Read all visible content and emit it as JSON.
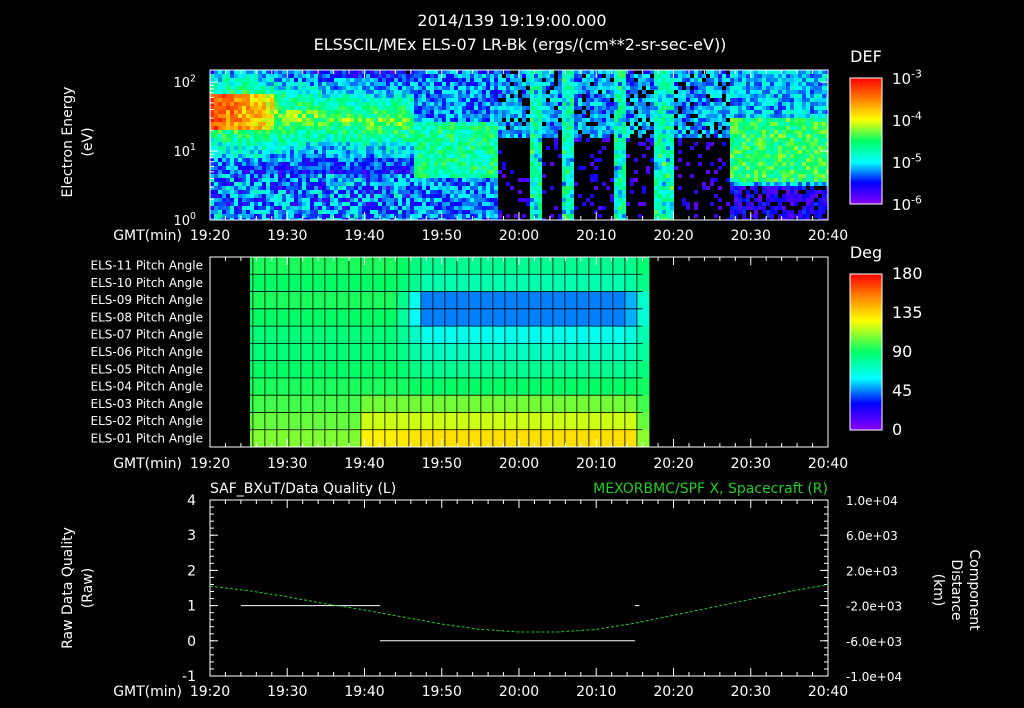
{
  "header": {
    "timestamp": "2014/139 19:19:00.000",
    "title": "ELSSCIL/MEx ELS-07 LR-Bk  (ergs/(cm**2-sr-sec-eV))"
  },
  "colors": {
    "foreground": "#ffffff",
    "background": "#000000",
    "spacecraft_trace": "#22cc22",
    "quality_trace": "#ffffff"
  },
  "time_axis": {
    "label": "GMT(min)",
    "ticks": [
      "19:20",
      "19:30",
      "19:40",
      "19:50",
      "20:00",
      "20:10",
      "20:20",
      "20:30",
      "20:40"
    ],
    "range_min": [
      20,
      100
    ]
  },
  "chart_data": [
    {
      "type": "heatmap",
      "ylabel": "Electron Energy (eV)",
      "ylabel_lines": [
        "Electron Energy",
        "(eV)"
      ],
      "y_scale": "log",
      "ylim": [
        1,
        150
      ],
      "yticks": [
        {
          "value": 1,
          "base": "10",
          "exp": "0"
        },
        {
          "value": 10,
          "base": "10",
          "exp": "1"
        },
        {
          "value": 100,
          "base": "10",
          "exp": "2"
        }
      ],
      "colorbar": {
        "label": "DEF",
        "scale": "log",
        "range": [
          1e-06,
          0.001
        ],
        "ticks": [
          {
            "base": "10",
            "exp": "-3"
          },
          {
            "base": "10",
            "exp": "-4"
          },
          {
            "base": "10",
            "exp": "-5"
          },
          {
            "base": "10",
            "exp": "-6"
          }
        ]
      }
    },
    {
      "type": "heatmap",
      "y_categories": [
        "ELS-11 Pitch Angle",
        "ELS-10 Pitch Angle",
        "ELS-09 Pitch Angle",
        "ELS-08 Pitch Angle",
        "ELS-07 Pitch Angle",
        "ELS-06 Pitch Angle",
        "ELS-05 Pitch Angle",
        "ELS-04 Pitch Angle",
        "ELS-03 Pitch Angle",
        "ELS-02 Pitch Angle",
        "ELS-01 Pitch Angle"
      ],
      "data_time_range_min": [
        24,
        76
      ],
      "colorbar": {
        "label": "Deg",
        "range": [
          0,
          180
        ],
        "ticks": [
          "180",
          "135",
          "90",
          "45",
          "0"
        ]
      }
    },
    {
      "type": "line",
      "left_title": "SAF_BXuT/Data Quality (L)",
      "right_title": "MEXORBMC/SPF X, Spacecraft (R)",
      "left_ylabel_lines": [
        "Raw Data Quality",
        "(Raw)"
      ],
      "right_ylabel_lines": [
        "Component",
        "Distance",
        "(km)"
      ],
      "left_ylim": [
        -1,
        4
      ],
      "left_ticks": [
        "4",
        "3",
        "2",
        "1",
        "0",
        "-1"
      ],
      "right_ylim": [
        -10000,
        10000
      ],
      "right_ticks": [
        "1.0e+04",
        "6.0e+03",
        "2.0e+03",
        "-2.0e+03",
        "-6.0e+03",
        "-1.0e+04"
      ],
      "series": [
        {
          "name": "SAF_BXuT/Data Quality",
          "axis": "left",
          "segments": [
            {
              "x": [
                24,
                42
              ],
              "y": [
                1,
                1
              ]
            },
            {
              "x": [
                42,
                75
              ],
              "y": [
                0,
                0
              ]
            },
            {
              "x": [
                75,
                75.6
              ],
              "y": [
                1,
                1
              ]
            }
          ]
        },
        {
          "name": "MEXORBMC/SPF X, Spacecraft",
          "axis": "right",
          "x": [
            20,
            25,
            30,
            35,
            40,
            45,
            50,
            55,
            60,
            65,
            70,
            75,
            80,
            85,
            90,
            95,
            100
          ],
          "y": [
            200,
            -300,
            -1000,
            -1800,
            -2500,
            -3300,
            -4100,
            -4700,
            -5000,
            -5000,
            -4700,
            -4000,
            -3100,
            -2200,
            -1300,
            -400,
            400
          ]
        }
      ]
    }
  ]
}
